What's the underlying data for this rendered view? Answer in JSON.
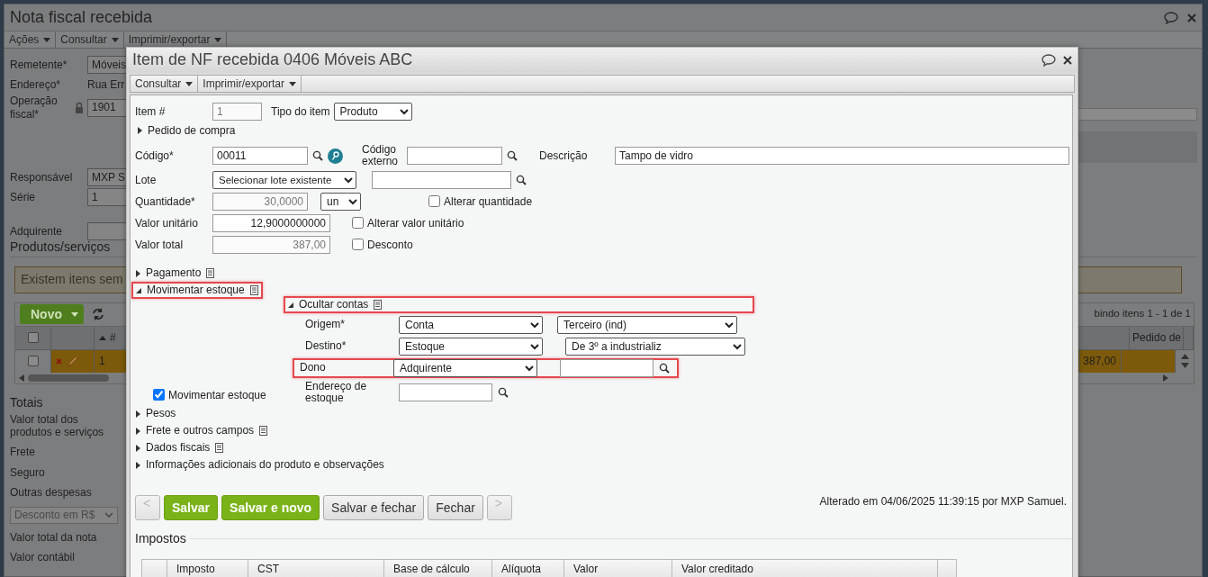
{
  "background_window": {
    "title": "Nota fiscal recebida",
    "menu": [
      {
        "label": "Ações"
      },
      {
        "label": "Consultar"
      },
      {
        "label": "Imprimir/exportar"
      }
    ],
    "fields": [
      {
        "label": "Remetente*",
        "kind": "input",
        "value": "Móveis"
      },
      {
        "label": "Endereço*",
        "kind": "text",
        "value": "Rua Err"
      },
      {
        "label": "Operação fiscal*",
        "kind": "locked",
        "value": "1901"
      },
      {
        "label": "Responsável",
        "kind": "input",
        "value": "MXP S"
      },
      {
        "label": "Série",
        "kind": "input",
        "value": "1"
      },
      {
        "label": "Adquirente",
        "kind": "input"
      }
    ],
    "products_title": "Produtos/serviços",
    "warning": "Existem itens sem",
    "new_button": "Novo",
    "pager": "bindo itens 1 - 1 de 1",
    "grid_columns": [
      "#",
      "Pedido de"
    ],
    "select_all": {
      "checked": false
    },
    "rows": [
      {
        "number": "1",
        "total": "387,00",
        "selected": true,
        "checked": false
      }
    ],
    "totals_title": "Totais",
    "totals": [
      {
        "kind": "label",
        "label": "Valor total dos produtos e serviços"
      },
      {
        "kind": "label",
        "label": "Frete"
      },
      {
        "kind": "label",
        "label": "Seguro"
      },
      {
        "kind": "label",
        "label": "Outras despesas"
      },
      {
        "kind": "select",
        "value": "Desconto em R$"
      },
      {
        "kind": "label",
        "label": "Valor total da nota"
      },
      {
        "kind": "label",
        "label": "Valor contábil"
      }
    ]
  },
  "dialog": {
    "title": "Item de NF recebida 0406 Móveis ABC",
    "menu": [
      {
        "label": "Consultar"
      },
      {
        "label": "Imprimir/exportar"
      }
    ],
    "item_number": {
      "label": "Item #",
      "value": "1"
    },
    "item_type": {
      "label": "Tipo do item",
      "value": "Produto"
    },
    "purchase_order": {
      "label": "Pedido de compra",
      "expanded": false
    },
    "code": {
      "label": "Código*",
      "value": "00011"
    },
    "external_code": {
      "label": "Código externo"
    },
    "description": {
      "label": "Descrição",
      "value": "Tampo de vidro"
    },
    "lot": {
      "label": "Lote",
      "value": "Selecionar lote existente"
    },
    "quantity": {
      "label": "Quantidade*",
      "value": "30,0000",
      "unit": "un",
      "option": {
        "label": "Alterar quantidade",
        "checked": false
      }
    },
    "unit_value": {
      "label": "Valor unitário",
      "value": "12,9000000000",
      "option": {
        "label": "Alterar valor unitário",
        "checked": false
      }
    },
    "total_value": {
      "label": "Valor total",
      "value": "387,00",
      "option": {
        "label": "Desconto",
        "checked": false
      }
    },
    "sections": [
      {
        "label": "Pagamento",
        "expanded": false,
        "note": true,
        "highlighted": false
      },
      {
        "label": "Movimentar estoque",
        "expanded": true,
        "note": true,
        "highlighted": true,
        "stock": {
          "toggle": {
            "label": "Ocultar contas",
            "expanded": true,
            "note": true,
            "highlighted": true
          },
          "rows": [
            {
              "kind": "double-select",
              "label": "Origem*",
              "value": "Conta",
              "value2": "Terceiro (ind)",
              "highlighted": false
            },
            {
              "kind": "double-select",
              "label": "Destino*",
              "value": "Estoque",
              "value2": "De 3º a industrializ",
              "highlighted": false
            },
            {
              "kind": "select-search",
              "label": "Dono",
              "value": "Adquirente",
              "highlighted": true
            },
            {
              "kind": "search",
              "label": "Endereço de estoque",
              "highlighted": false
            }
          ],
          "move_stock": {
            "label": "Movimentar estoque",
            "checked": true
          }
        }
      },
      {
        "label": "Pesos",
        "expanded": false,
        "note": false,
        "highlighted": false
      },
      {
        "label": "Frete e outros campos",
        "expanded": false,
        "note": true,
        "highlighted": false
      },
      {
        "label": "Dados fiscais",
        "expanded": false,
        "note": true,
        "highlighted": false
      },
      {
        "label": "Informações adicionais do produto e observações",
        "expanded": false,
        "note": false,
        "highlighted": false
      }
    ],
    "buttons": [
      {
        "label": "<",
        "kind": "nav",
        "disabled": true
      },
      {
        "label": "Salvar",
        "kind": "primary",
        "disabled": false
      },
      {
        "label": "Salvar e novo",
        "kind": "primary",
        "disabled": false
      },
      {
        "label": "Salvar e fechar",
        "kind": "secondary",
        "disabled": false
      },
      {
        "label": "Fechar",
        "kind": "secondary",
        "disabled": false
      },
      {
        "label": ">",
        "kind": "nav",
        "disabled": true
      }
    ],
    "audit": "Alterado em 04/06/2025 11:39:15 por MXP Samuel.",
    "taxes": {
      "title": "Impostos",
      "columns": [
        "Imposto",
        "CST",
        "Base de cálculo",
        "Alíquota",
        "Valor",
        "Valor creditado"
      ]
    }
  }
}
